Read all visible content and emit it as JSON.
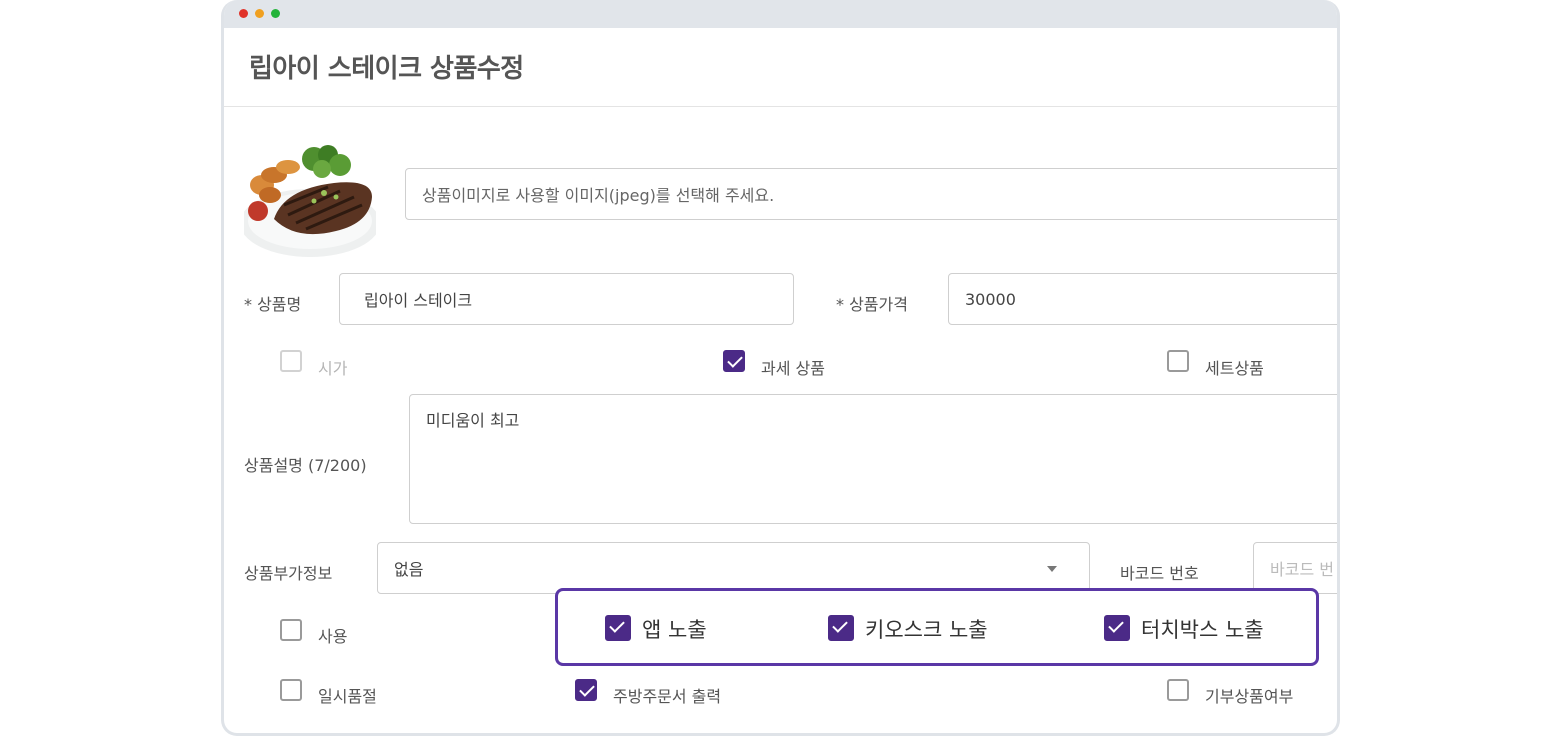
{
  "page": {
    "title": "립아이 스테이크 상품수정"
  },
  "image_upload": {
    "placeholder": "상품이미지로 사용할 이미지(jpeg)를 선택해 주세요."
  },
  "product_name": {
    "label": "* 상품명",
    "value": "립아이 스테이크"
  },
  "product_price": {
    "label": "* 상품가격",
    "value": "30000"
  },
  "options_row1": [
    {
      "label": "시가",
      "checked": false,
      "disabled": true
    },
    {
      "label": "과세 상품",
      "checked": true,
      "disabled": false
    },
    {
      "label": "세트상품",
      "checked": false,
      "disabled": false
    }
  ],
  "description": {
    "label": "상품설명 (7/200)",
    "value": "미디움이 최고"
  },
  "extra_info": {
    "label": "상품부가정보",
    "value": "없음"
  },
  "barcode": {
    "label": "바코드 번호",
    "placeholder": "바코드 번"
  },
  "use_option": {
    "label": "사용",
    "checked": false
  },
  "exposure": [
    {
      "label": "앱 노출",
      "checked": true
    },
    {
      "label": "키오스크 노출",
      "checked": true
    },
    {
      "label": "터치박스 노출",
      "checked": true
    }
  ],
  "options_row3": [
    {
      "label": "일시품절",
      "checked": false
    },
    {
      "label": "주방주문서 출력",
      "checked": true
    },
    {
      "label": "기부상품여부",
      "checked": false
    }
  ],
  "colors": {
    "accent": "#4b2a87",
    "highlight_border": "#5a37a6"
  }
}
